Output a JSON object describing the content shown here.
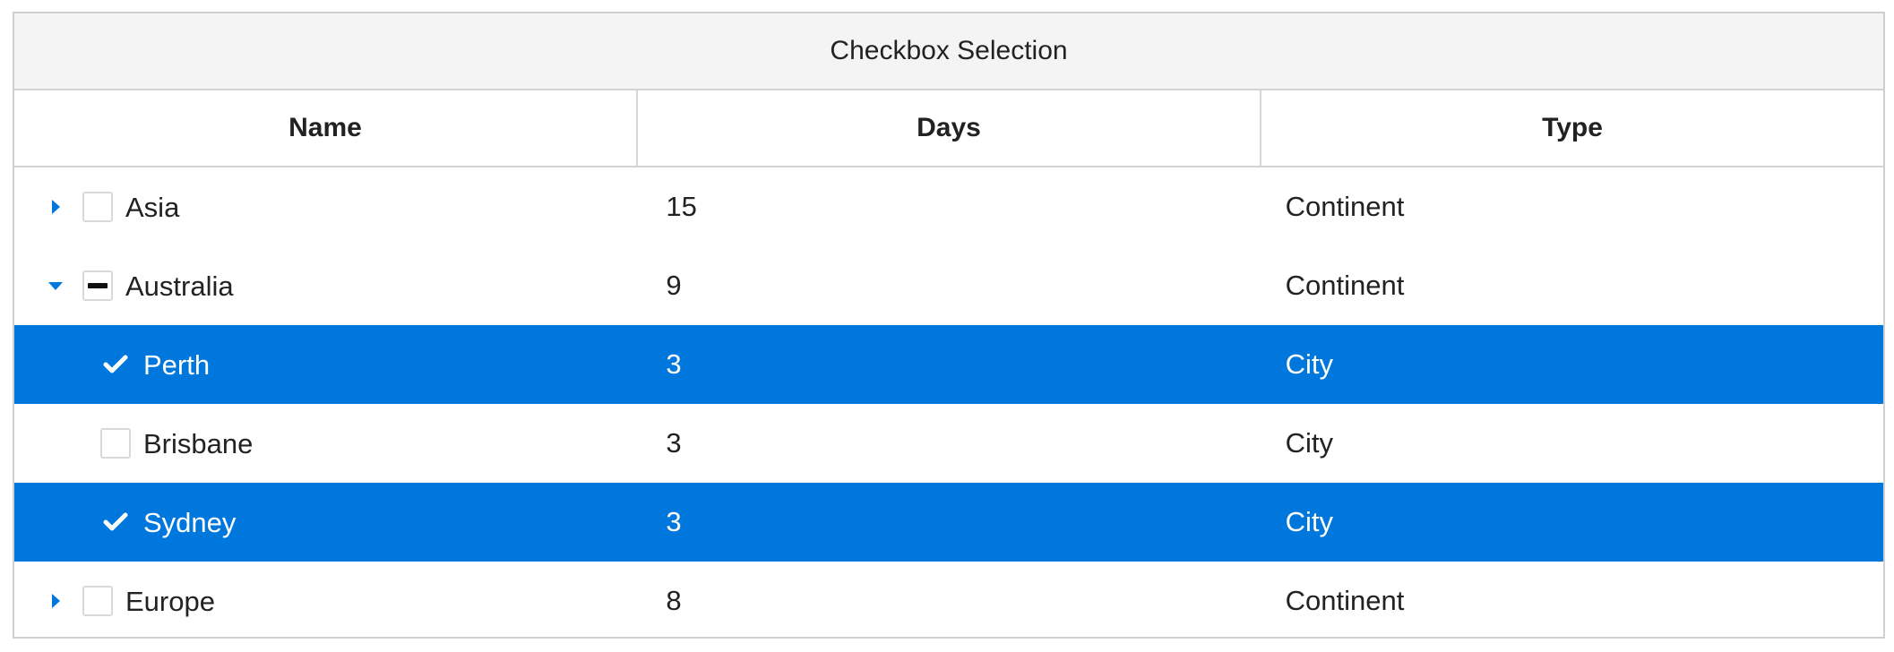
{
  "table": {
    "caption": "Checkbox Selection",
    "columns": {
      "name": "Name",
      "days": "Days",
      "type": "Type"
    },
    "rows": [
      {
        "name": "Asia",
        "days": "15",
        "type": "Continent",
        "level": 0,
        "toggle": "collapsed",
        "check": "unchecked",
        "selected": false
      },
      {
        "name": "Australia",
        "days": "9",
        "type": "Continent",
        "level": 0,
        "toggle": "expanded",
        "check": "partial",
        "selected": false
      },
      {
        "name": "Perth",
        "days": "3",
        "type": "City",
        "level": 1,
        "toggle": "none",
        "check": "checked",
        "selected": true
      },
      {
        "name": "Brisbane",
        "days": "3",
        "type": "City",
        "level": 1,
        "toggle": "none",
        "check": "unchecked",
        "selected": false
      },
      {
        "name": "Sydney",
        "days": "3",
        "type": "City",
        "level": 1,
        "toggle": "none",
        "check": "checked",
        "selected": true
      },
      {
        "name": "Europe",
        "days": "8",
        "type": "Continent",
        "level": 0,
        "toggle": "collapsed",
        "check": "unchecked",
        "selected": false
      }
    ]
  },
  "colors": {
    "accent": "#0077dd",
    "selected_text": "#ffffff",
    "caption_bg": "#f4f4f4",
    "border": "#d3d3d3"
  },
  "icons": {
    "collapsed": "caret-right-icon",
    "expanded": "caret-down-icon",
    "checked": "checkmark-icon",
    "partial": "minus-icon"
  }
}
